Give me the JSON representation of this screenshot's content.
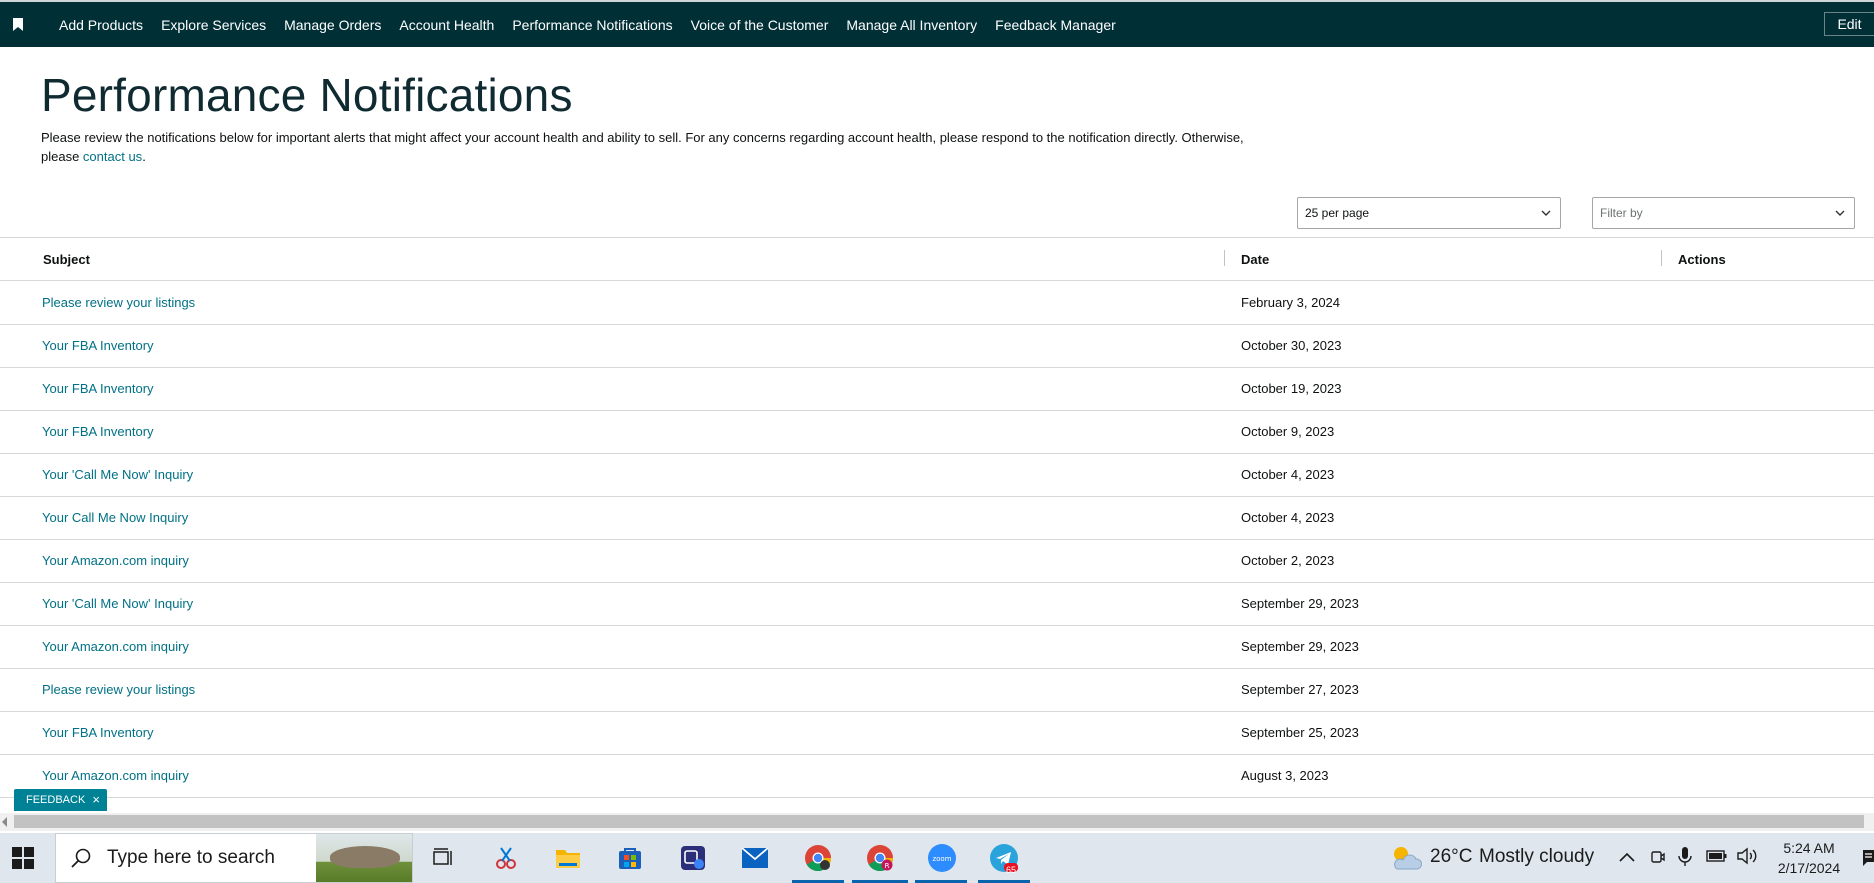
{
  "nav": {
    "items": [
      "Add Products",
      "Explore Services",
      "Manage Orders",
      "Account Health",
      "Performance Notifications",
      "Voice of the Customer",
      "Manage All Inventory",
      "Feedback Manager"
    ],
    "edit_label": "Edit"
  },
  "page": {
    "title": "Performance Notifications",
    "intro_text": "Please review the notifications below for important alerts that might affect your account health and ability to sell. For any concerns regarding account health, please respond to the notification directly. Otherwise, please ",
    "contact_link": "contact us",
    "intro_end": "."
  },
  "controls": {
    "per_page_value": "25 per page",
    "filter_placeholder": "Filter by"
  },
  "table": {
    "headers": {
      "subject": "Subject",
      "date": "Date",
      "actions": "Actions"
    },
    "rows": [
      {
        "subject": "Please review your listings",
        "date": "February 3, 2024"
      },
      {
        "subject": "Your FBA Inventory",
        "date": "October 30, 2023"
      },
      {
        "subject": "Your FBA Inventory",
        "date": "October 19, 2023"
      },
      {
        "subject": "Your FBA Inventory",
        "date": "October 9, 2023"
      },
      {
        "subject": "Your 'Call Me Now' Inquiry",
        "date": "October 4, 2023"
      },
      {
        "subject": "Your Call Me Now Inquiry",
        "date": "October 4, 2023"
      },
      {
        "subject": "Your Amazon.com inquiry",
        "date": "October 2, 2023"
      },
      {
        "subject": "Your 'Call Me Now' Inquiry",
        "date": "September 29, 2023"
      },
      {
        "subject": "Your Amazon.com inquiry",
        "date": "September 29, 2023"
      },
      {
        "subject": "Please review your listings",
        "date": "September 27, 2023"
      },
      {
        "subject": "Your FBA Inventory",
        "date": "September 25, 2023"
      },
      {
        "subject": "Your Amazon.com inquiry",
        "date": "August 3, 2023"
      }
    ]
  },
  "feedback": {
    "label": "FEEDBACK",
    "close": "×"
  },
  "taskbar": {
    "search_placeholder": "Type here to search",
    "weather": {
      "temp": "26°C",
      "condition": "Mostly cloudy"
    },
    "time": "5:24 AM",
    "date": "2/17/2024",
    "telegram_badge": "65",
    "apps": [
      "task-view",
      "snipping",
      "file-explorer",
      "microsoft-store",
      "teams",
      "mail",
      "chrome",
      "chrome-profile",
      "zoom",
      "telegram"
    ]
  },
  "colors": {
    "nav_bg": "#002f36",
    "link": "#007185",
    "feedback_bg": "#008296",
    "taskbar_bg": "#dfe6ee"
  }
}
